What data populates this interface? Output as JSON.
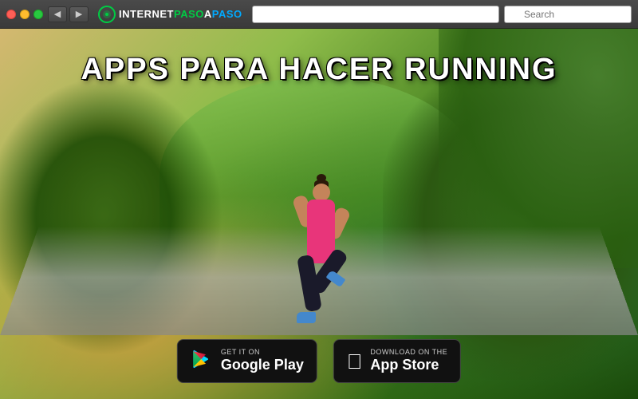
{
  "browser": {
    "traffic_lights": [
      "red",
      "yellow",
      "green"
    ],
    "nav_back_label": "◀",
    "nav_forward_label": "▶",
    "logo_text_internet": "INTERNET",
    "logo_text_paso1": "PASO",
    "logo_separator": "A",
    "logo_text_paso2": "PASO",
    "address_bar_value": "",
    "search_placeholder": "Search"
  },
  "main": {
    "title": "APPS PARA HACER RUNNING",
    "google_play": {
      "sub_label": "GET IT ON",
      "name_label": "Google Play"
    },
    "app_store": {
      "sub_label": "Download on the",
      "name_label": "App Store"
    }
  }
}
